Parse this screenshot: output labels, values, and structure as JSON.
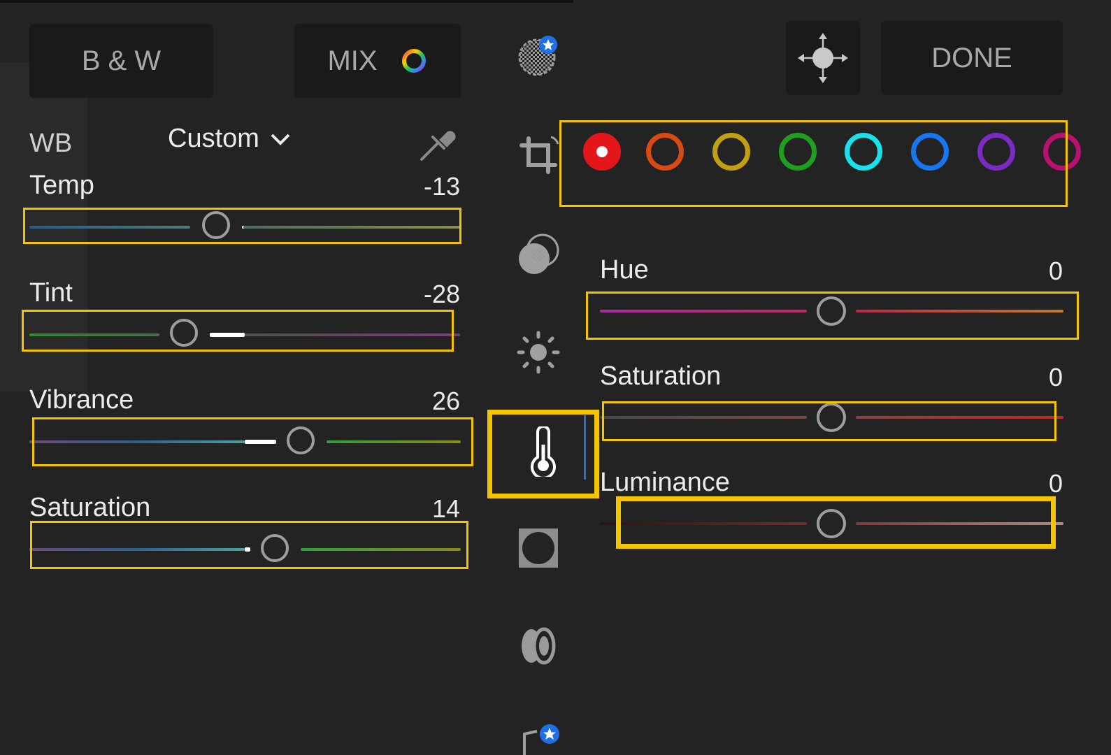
{
  "top_buttons": {
    "bw_label": "B & W",
    "mix_label": "MIX",
    "done_label": "DONE"
  },
  "wb": {
    "label": "WB",
    "preset": "Custom"
  },
  "left_sliders": [
    {
      "label": "Temp",
      "value": "-13"
    },
    {
      "label": "Tint",
      "value": "-28"
    },
    {
      "label": "Vibrance",
      "value": "26"
    },
    {
      "label": "Saturation",
      "value": "14"
    }
  ],
  "color_swatches": [
    {
      "name": "red",
      "color": "#e3171b",
      "selected": true
    },
    {
      "name": "orange",
      "color": "#d94a12"
    },
    {
      "name": "yellow",
      "color": "#c2a011"
    },
    {
      "name": "green",
      "color": "#1f9e22"
    },
    {
      "name": "aqua",
      "color": "#19e0ea"
    },
    {
      "name": "blue",
      "color": "#1677f0"
    },
    {
      "name": "purple",
      "color": "#7a2bc4"
    },
    {
      "name": "magenta",
      "color": "#b8126e"
    }
  ],
  "right_sliders": [
    {
      "label": "Hue",
      "value": "0"
    },
    {
      "label": "Saturation",
      "value": "0"
    },
    {
      "label": "Luminance",
      "value": "0"
    }
  ],
  "toolbar_icons": [
    "selective-adjust-icon",
    "crop-icon",
    "masking-icon",
    "light-icon",
    "color-temperature-icon",
    "vignette-icon",
    "optics-icon",
    "geometry-icon"
  ],
  "accent_color": "#f5c400"
}
